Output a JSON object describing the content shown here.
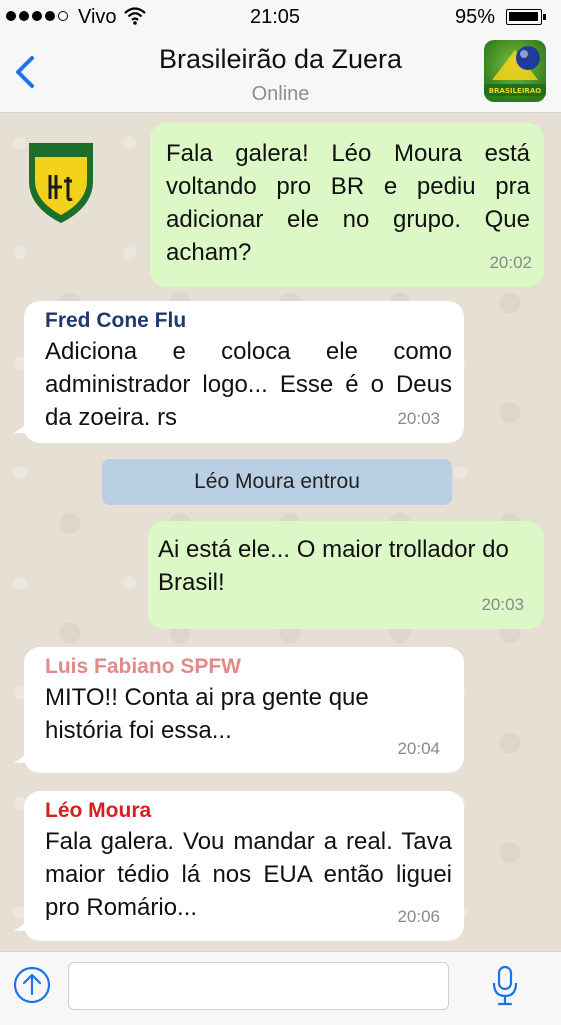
{
  "status_bar": {
    "carrier": "Vivo",
    "time": "21:05",
    "battery": "95%",
    "signal_bars": 4,
    "signal_total": 5,
    "battery_level": 0.95
  },
  "header": {
    "title": "Brasileirão da Zuera",
    "subtitle": "Online",
    "back_icon": "chevron-left-icon",
    "avatar_text": "BRASILEIRAO"
  },
  "messages": [
    {
      "direction": "outgoing",
      "text": "Fala galera! Léo Moura está voltando pro BR e pediu pra adicionar ele no grupo. Que acham?",
      "time": "20:02"
    },
    {
      "direction": "incoming",
      "sender": "Fred Cone Flu",
      "sender_color": "#1f3a6e",
      "text": "Adiciona e coloca ele como administrador logo... Esse é o Deus da zoeira. rs",
      "time": "20:03"
    },
    {
      "type": "system",
      "text": "Léo Moura entrou"
    },
    {
      "direction": "outgoing",
      "text": "Ai está ele... O maior trollador do Brasil!",
      "time": "20:03"
    },
    {
      "direction": "incoming",
      "sender": "Luis Fabiano SPFW",
      "sender_color": "#e08a8a",
      "text": "MITO!! Conta ai pra gente que história foi essa...",
      "time": "20:04"
    },
    {
      "direction": "incoming",
      "sender": "Léo Moura",
      "sender_color": "#d62020",
      "text": "Fala galera. Vou mandar a real. Tava maior tédio lá nos EUA então liguei pro Romário...",
      "time": "20:06"
    }
  ],
  "input_bar": {
    "placeholder": "",
    "value": "",
    "upload_icon": "arrow-up-circle-icon",
    "mic_icon": "microphone-icon"
  },
  "colors": {
    "outgoing_bubble": "#dcf8c6",
    "incoming_bubble": "#ffffff",
    "system_banner": "#b9cfe4",
    "accent": "#1a73e8"
  }
}
